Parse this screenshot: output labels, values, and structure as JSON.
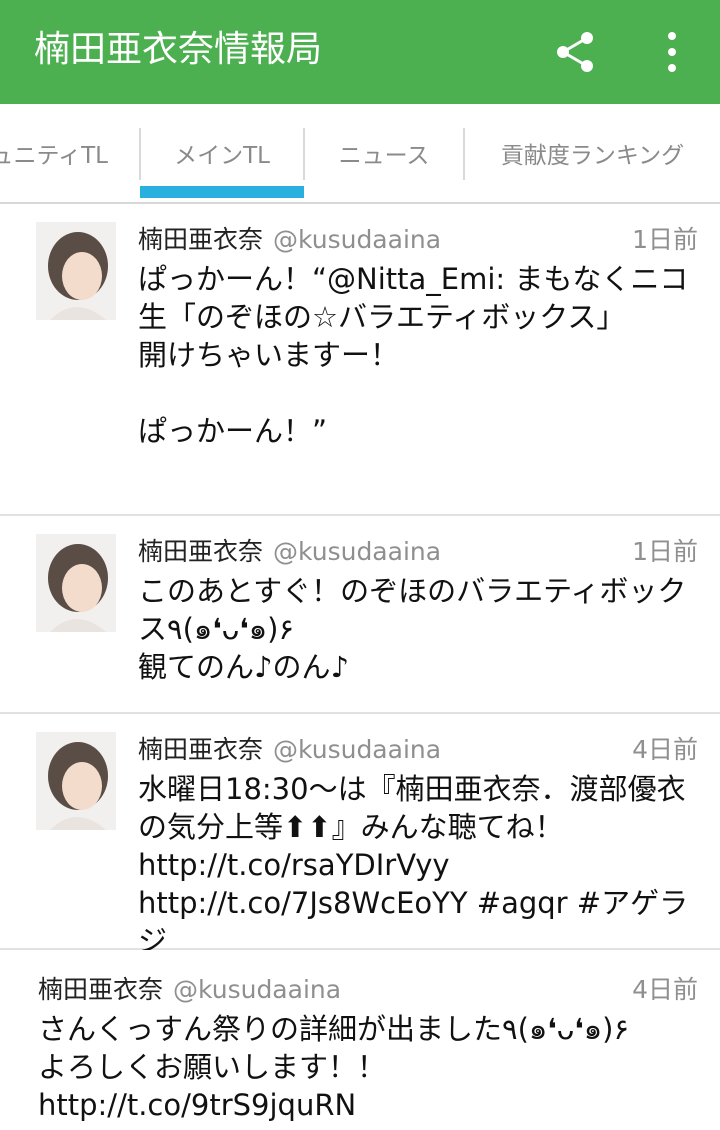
{
  "appbar": {
    "title": "楠田亜衣奈情報局",
    "share_icon": "share-icon",
    "more_icon": "more-vert-icon",
    "color": "#4caf50"
  },
  "tabs": [
    {
      "label": "ュニティTL"
    },
    {
      "label": "メインTL",
      "selected": true
    },
    {
      "label": "ニュース"
    },
    {
      "label": "貢献度ランキング"
    }
  ],
  "tab_indicator_color": "#2ab0df",
  "tweets": [
    {
      "name": "楠田亜衣奈",
      "handle": "@kusudaaina",
      "time": "1日前",
      "text": "ぱっかーん！“@Nitta_Emi: まもなくニコ生「のぞほの☆バラエティボックス」\n開けちゃいますー！\n\nぱっかーん！”"
    },
    {
      "name": "楠田亜衣奈",
      "handle": "@kusudaaina",
      "time": "1日前",
      "text": "このあとすぐ！のぞほのバラエティボックス٩(๑❛ᴗ❛๑)۶\n観てのん♪のん♪"
    },
    {
      "name": "楠田亜衣奈",
      "handle": "@kusudaaina",
      "time": "4日前",
      "text": "水曜日18:30〜は『楠田亜衣奈．渡部優衣の気分上等⬆︎⬆︎』みんな聴てね！http://t.co/rsaYDIrVyy http://t.co/7Js8WcEoYY #agqr #アゲラジ"
    },
    {
      "name": "楠田亜衣奈",
      "handle": "@kusudaaina",
      "time": "4日前",
      "text": "さんくっすん祭りの詳細が出ました٩(๑❛ᴗ❛๑)۶\nよろしくお願いします！！http://t.co/9trS9jquRN"
    }
  ]
}
